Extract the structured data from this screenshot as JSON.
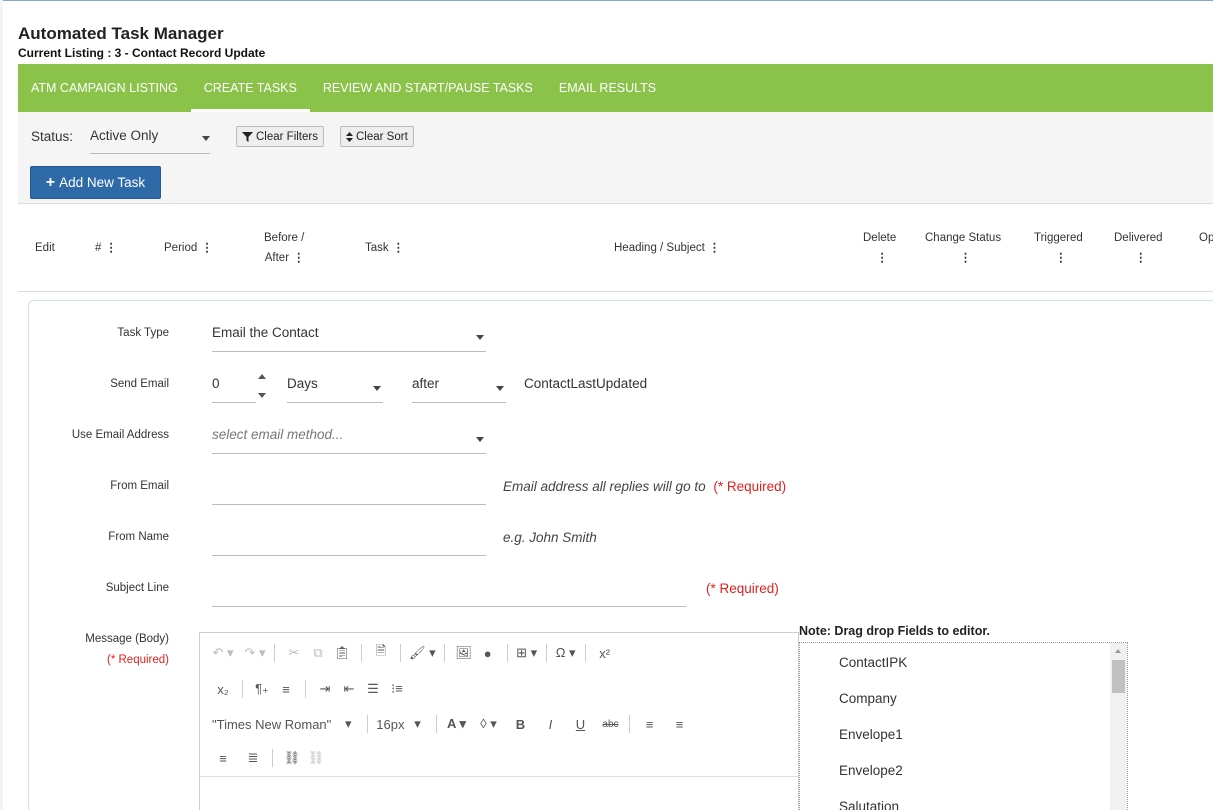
{
  "header": {
    "title": "Automated Task Manager",
    "current_listing": "Current Listing : 3 - Contact Record Update"
  },
  "nav": {
    "tabs": [
      {
        "label": "ATM CAMPAIGN LISTING"
      },
      {
        "label": "CREATE TASKS",
        "active": true
      },
      {
        "label": "REVIEW AND START/PAUSE TASKS"
      },
      {
        "label": "EMAIL RESULTS"
      }
    ]
  },
  "toolbar": {
    "status_label": "Status:",
    "status_value": "Active Only",
    "clear_filters": "Clear Filters",
    "clear_sort": "Clear Sort",
    "add_new_task": "Add New Task"
  },
  "table": {
    "columns": [
      "Edit",
      "#",
      "Period",
      "Before /",
      "After",
      "Task",
      "Heading / Subject",
      "Delete",
      "Change Status",
      "Triggered",
      "Delivered",
      "Op"
    ]
  },
  "form": {
    "task_type": {
      "label": "Task Type",
      "value": "Email the Contact"
    },
    "send_email": {
      "label": "Send Email",
      "number": "0",
      "unit": "Days",
      "relation": "after",
      "field": "ContactLastUpdated"
    },
    "use_email_address": {
      "label": "Use Email Address",
      "placeholder": "select email method..."
    },
    "from_email": {
      "label": "From Email",
      "value": "",
      "hint": "Email address all replies will go to",
      "required": "(* Required)"
    },
    "from_name": {
      "label": "From Name",
      "value": "",
      "hint": "e.g. John Smith"
    },
    "subject_line": {
      "label": "Subject Line",
      "value": "",
      "required": "(* Required)"
    },
    "message": {
      "label": "Message (Body)",
      "required": "(* Required)"
    }
  },
  "editor": {
    "font_family": "\"Times New Roman\"",
    "font_size": "16px"
  },
  "fields_panel": {
    "note": "Note: Drag drop Fields to editor.",
    "items": [
      "ContactIPK",
      "Company",
      "Envelope1",
      "Envelope2",
      "Salutation"
    ]
  }
}
